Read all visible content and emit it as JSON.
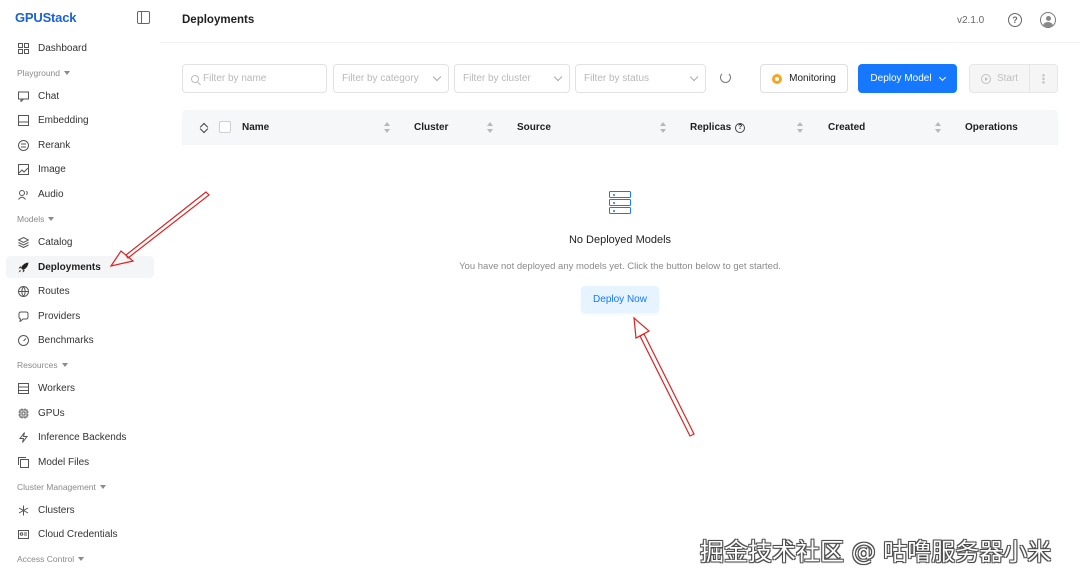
{
  "app": {
    "logo": "GPUStack",
    "version": "v2.1.0"
  },
  "header": {
    "title": "Deployments"
  },
  "sidebar": {
    "items": [
      {
        "label": "Dashboard",
        "icon": "dashboard-icon"
      },
      {
        "group": "Playground"
      },
      {
        "label": "Chat",
        "icon": "chat-icon"
      },
      {
        "label": "Embedding",
        "icon": "embedding-icon"
      },
      {
        "label": "Rerank",
        "icon": "rerank-icon"
      },
      {
        "label": "Image",
        "icon": "image-icon"
      },
      {
        "label": "Audio",
        "icon": "audio-icon"
      },
      {
        "group": "Models"
      },
      {
        "label": "Catalog",
        "icon": "catalog-icon"
      },
      {
        "label": "Deployments",
        "icon": "rocket-icon",
        "active": true
      },
      {
        "label": "Routes",
        "icon": "routes-icon"
      },
      {
        "label": "Providers",
        "icon": "providers-icon"
      },
      {
        "label": "Benchmarks",
        "icon": "gauge-icon"
      },
      {
        "group": "Resources"
      },
      {
        "label": "Workers",
        "icon": "server-icon"
      },
      {
        "label": "GPUs",
        "icon": "chip-icon"
      },
      {
        "label": "Inference Backends",
        "icon": "lightning-icon"
      },
      {
        "label": "Model Files",
        "icon": "files-icon"
      },
      {
        "group": "Cluster Management"
      },
      {
        "label": "Clusters",
        "icon": "cluster-icon"
      },
      {
        "label": "Cloud Credentials",
        "icon": "credential-icon"
      },
      {
        "group": "Access Control"
      }
    ]
  },
  "filters": {
    "name_placeholder": "Filter by name",
    "category_placeholder": "Filter by category",
    "cluster_placeholder": "Filter by cluster",
    "status_placeholder": "Filter by status"
  },
  "toolbar": {
    "monitoring_label": "Monitoring",
    "deploy_model_label": "Deploy Model",
    "start_label": "Start",
    "more_label": "⋮"
  },
  "table": {
    "columns": [
      "Name",
      "Cluster",
      "Source",
      "Replicas",
      "Created",
      "Operations"
    ]
  },
  "empty_state": {
    "title": "No Deployed Models",
    "description": "You have not deployed any models yet. Click the button below to get started.",
    "button_label": "Deploy Now"
  },
  "watermark": "掘金技术社区 @ 咕噜服务器小米",
  "colors": {
    "primary": "#1677ff",
    "annotation": "#e02020"
  }
}
